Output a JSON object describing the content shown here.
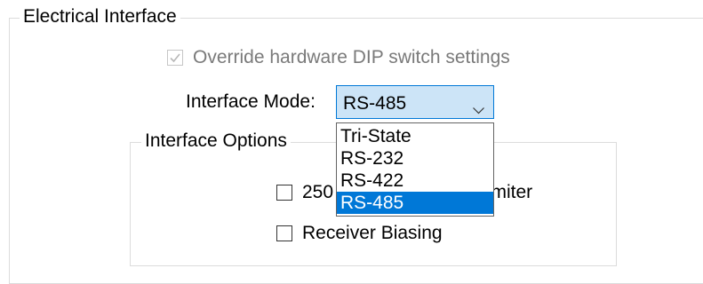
{
  "electrical_interface": {
    "legend": "Electrical Interface",
    "override": {
      "label": "Override hardware DIP switch settings",
      "checked": true,
      "enabled": false
    },
    "interface_mode": {
      "label": "Interface Mode:",
      "value": "RS-485",
      "icon": "chevron-down-icon",
      "dropdown_open": true,
      "options": [
        "Tri-State",
        "RS-232",
        "RS-422",
        "RS-485"
      ],
      "selected_index": 3
    }
  },
  "interface_options": {
    "legend": "Interface Options",
    "items": [
      {
        "label": "250 Kbps Slew Rate Limiter",
        "checked": false
      },
      {
        "label": "Receiver Biasing",
        "checked": false
      }
    ]
  },
  "colors": {
    "accent": "#0078d7",
    "combo_fill": "#cce4f7",
    "group_border": "#dcdcdc",
    "disabled_text": "#7a7a7a"
  }
}
